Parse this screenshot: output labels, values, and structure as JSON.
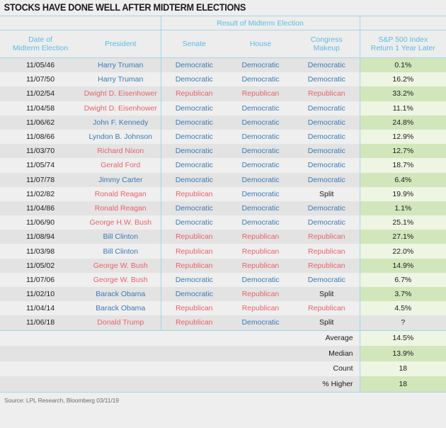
{
  "title": "STOCKS HAVE DONE WELL AFTER MIDTERM ELECTIONS",
  "header": {
    "group_label": "Result of Midterm Election",
    "date": "Date of\nMidterm Election",
    "date_line1": "Date of",
    "date_line2": "Midterm Election",
    "president": "President",
    "senate": "Senate",
    "house": "House",
    "congress_line1": "Congress",
    "congress_line2": "Makeup",
    "return_line1": "S&P 500 Index",
    "return_line2": "Return 1 Year Later"
  },
  "colors": {
    "democratic": "#3b7ab5",
    "republican": "#e8626c",
    "split": "#1a1a1a",
    "header_text": "#5bbce4",
    "rule": "#a8d4e8",
    "green_dark": "#d2e6bc",
    "green_light": "#eef5e3",
    "stripe_dark": "#e3e3e3",
    "stripe_light": "#efefef",
    "background": "#eeeeee"
  },
  "chart_data": {
    "type": "table",
    "title": "STOCKS HAVE DONE WELL AFTER MIDTERM ELECTIONS",
    "columns": [
      "Date of Midterm Election",
      "President",
      "Senate",
      "House",
      "Congress Makeup",
      "S&P 500 Index Return 1 Year Later"
    ],
    "rows": [
      {
        "date": "11/05/46",
        "president": "Harry Truman",
        "president_party": "dem",
        "senate": "Democratic",
        "senate_party": "dem",
        "house": "Democratic",
        "house_party": "dem",
        "congress": "Democratic",
        "congress_party": "dem",
        "ret": "0.1%",
        "ret_value": 0.1
      },
      {
        "date": "11/07/50",
        "president": "Harry Truman",
        "president_party": "dem",
        "senate": "Democratic",
        "senate_party": "dem",
        "house": "Democratic",
        "house_party": "dem",
        "congress": "Democratic",
        "congress_party": "dem",
        "ret": "16.2%",
        "ret_value": 16.2
      },
      {
        "date": "11/02/54",
        "president": "Dwight D. Eisenhower",
        "president_party": "rep",
        "senate": "Republican",
        "senate_party": "rep",
        "house": "Republican",
        "house_party": "rep",
        "congress": "Republican",
        "congress_party": "rep",
        "ret": "33.2%",
        "ret_value": 33.2
      },
      {
        "date": "11/04/58",
        "president": "Dwight D. Eisenhower",
        "president_party": "rep",
        "senate": "Democratic",
        "senate_party": "dem",
        "house": "Democratic",
        "house_party": "dem",
        "congress": "Democratic",
        "congress_party": "dem",
        "ret": "11.1%",
        "ret_value": 11.1
      },
      {
        "date": "11/06/62",
        "president": "John F. Kennedy",
        "president_party": "dem",
        "senate": "Democratic",
        "senate_party": "dem",
        "house": "Democratic",
        "house_party": "dem",
        "congress": "Democratic",
        "congress_party": "dem",
        "ret": "24.8%",
        "ret_value": 24.8
      },
      {
        "date": "11/08/66",
        "president": "Lyndon B. Johnson",
        "president_party": "dem",
        "senate": "Democratic",
        "senate_party": "dem",
        "house": "Democratic",
        "house_party": "dem",
        "congress": "Democratic",
        "congress_party": "dem",
        "ret": "12.9%",
        "ret_value": 12.9
      },
      {
        "date": "11/03/70",
        "president": "Richard Nixon",
        "president_party": "rep",
        "senate": "Democratic",
        "senate_party": "dem",
        "house": "Democratic",
        "house_party": "dem",
        "congress": "Democratic",
        "congress_party": "dem",
        "ret": "12.7%",
        "ret_value": 12.7
      },
      {
        "date": "11/05/74",
        "president": "Gerald Ford",
        "president_party": "rep",
        "senate": "Democratic",
        "senate_party": "dem",
        "house": "Democratic",
        "house_party": "dem",
        "congress": "Democratic",
        "congress_party": "dem",
        "ret": "18.7%",
        "ret_value": 18.7
      },
      {
        "date": "11/07/78",
        "president": "Jimmy Carter",
        "president_party": "dem",
        "senate": "Democratic",
        "senate_party": "dem",
        "house": "Democratic",
        "house_party": "dem",
        "congress": "Democratic",
        "congress_party": "dem",
        "ret": "6.4%",
        "ret_value": 6.4
      },
      {
        "date": "11/02/82",
        "president": "Ronald Reagan",
        "president_party": "rep",
        "senate": "Republican",
        "senate_party": "rep",
        "house": "Democratic",
        "house_party": "dem",
        "congress": "Split",
        "congress_party": "split",
        "ret": "19.9%",
        "ret_value": 19.9
      },
      {
        "date": "11/04/86",
        "president": "Ronald Reagan",
        "president_party": "rep",
        "senate": "Democratic",
        "senate_party": "dem",
        "house": "Democratic",
        "house_party": "dem",
        "congress": "Democratic",
        "congress_party": "dem",
        "ret": "1.1%",
        "ret_value": 1.1
      },
      {
        "date": "11/06/90",
        "president": "George H.W. Bush",
        "president_party": "rep",
        "senate": "Democratic",
        "senate_party": "dem",
        "house": "Democratic",
        "house_party": "dem",
        "congress": "Democratic",
        "congress_party": "dem",
        "ret": "25.1%",
        "ret_value": 25.1
      },
      {
        "date": "11/08/94",
        "president": "Bill Clinton",
        "president_party": "dem",
        "senate": "Republican",
        "senate_party": "rep",
        "house": "Republican",
        "house_party": "rep",
        "congress": "Republican",
        "congress_party": "rep",
        "ret": "27.1%",
        "ret_value": 27.1
      },
      {
        "date": "11/03/98",
        "president": "Bill Clinton",
        "president_party": "dem",
        "senate": "Republican",
        "senate_party": "rep",
        "house": "Republican",
        "house_party": "rep",
        "congress": "Republican",
        "congress_party": "rep",
        "ret": "22.0%",
        "ret_value": 22.0
      },
      {
        "date": "11/05/02",
        "president": "George W. Bush",
        "president_party": "rep",
        "senate": "Republican",
        "senate_party": "rep",
        "house": "Republican",
        "house_party": "rep",
        "congress": "Republican",
        "congress_party": "rep",
        "ret": "14.9%",
        "ret_value": 14.9
      },
      {
        "date": "11/07/06",
        "president": "George W. Bush",
        "president_party": "rep",
        "senate": "Democratic",
        "senate_party": "dem",
        "house": "Democratic",
        "house_party": "dem",
        "congress": "Democratic",
        "congress_party": "dem",
        "ret": "6.7%",
        "ret_value": 6.7
      },
      {
        "date": "11/02/10",
        "president": "Barack Obama",
        "president_party": "dem",
        "senate": "Democratic",
        "senate_party": "dem",
        "house": "Republican",
        "house_party": "rep",
        "congress": "Split",
        "congress_party": "split",
        "ret": "3.7%",
        "ret_value": 3.7
      },
      {
        "date": "11/04/14",
        "president": "Barack Obama",
        "president_party": "dem",
        "senate": "Republican",
        "senate_party": "rep",
        "house": "Republican",
        "house_party": "rep",
        "congress": "Republican",
        "congress_party": "rep",
        "ret": "4.5%",
        "ret_value": 4.5
      },
      {
        "date": "11/06/18",
        "president": "Donald Trump",
        "president_party": "rep",
        "senate": "Republican",
        "senate_party": "rep",
        "house": "Democratic",
        "house_party": "dem",
        "congress": "Split",
        "congress_party": "split",
        "ret": "?",
        "ret_value": null
      }
    ],
    "summary": [
      {
        "label": "Average",
        "value": "14.5%"
      },
      {
        "label": "Median",
        "value": "13.9%"
      },
      {
        "label": "Count",
        "value": "18"
      },
      {
        "label": "% Higher",
        "value": "18"
      }
    ]
  },
  "source": "Source: LPL Research, Bloomberg   03/11/19"
}
